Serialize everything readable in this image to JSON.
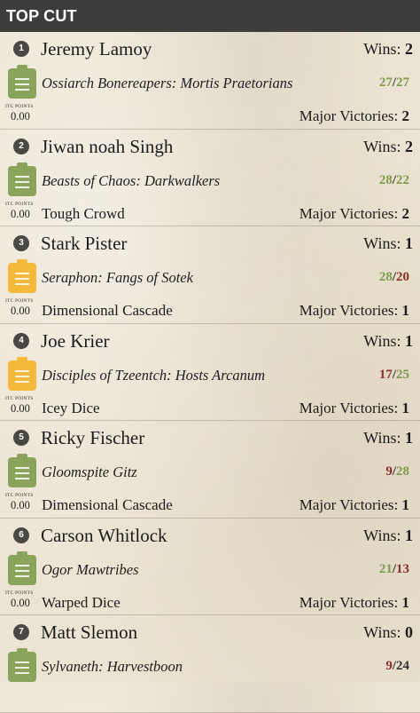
{
  "header": {
    "title": "TOP CUT"
  },
  "labels": {
    "wins": "Wins:",
    "major_victories": "Major Victories:",
    "itc_points": "ITC POINTS"
  },
  "players": [
    {
      "rank": "1",
      "name": "Jeremy Lamoy",
      "wins": "2",
      "faction": "Ossiarch Bonereapers: Mortis Praetorians",
      "record_a": "27",
      "record_b": "27",
      "color_a": "g",
      "color_b": "g",
      "itc": "0.00",
      "team": "",
      "major_victories": "2",
      "icon_color": "green"
    },
    {
      "rank": "2",
      "name": "Jiwan noah Singh",
      "wins": "2",
      "faction": "Beasts of Chaos: Darkwalkers",
      "record_a": "28",
      "record_b": "22",
      "color_a": "g",
      "color_b": "g",
      "itc": "0.00",
      "team": "Tough Crowd",
      "major_victories": "2",
      "icon_color": "green"
    },
    {
      "rank": "3",
      "name": "Stark Pister",
      "wins": "1",
      "faction": "Seraphon: Fangs of Sotek",
      "record_a": "28",
      "record_b": "20",
      "color_a": "g",
      "color_b": "r",
      "itc": "0.00",
      "team": "Dimensional Cascade",
      "major_victories": "1",
      "icon_color": "yellow"
    },
    {
      "rank": "4",
      "name": "Joe Krier",
      "wins": "1",
      "faction": "Disciples of Tzeentch: Hosts Arcanum",
      "record_a": "17",
      "record_b": "25",
      "color_a": "r",
      "color_b": "g",
      "itc": "0.00",
      "team": "Icey Dice",
      "major_victories": "1",
      "icon_color": "yellow"
    },
    {
      "rank": "5",
      "name": "Ricky Fischer",
      "wins": "1",
      "faction": "Gloomspite Gitz",
      "record_a": "9",
      "record_b": "28",
      "color_a": "r",
      "color_b": "g",
      "itc": "0.00",
      "team": "Dimensional Cascade",
      "major_victories": "1",
      "icon_color": "green"
    },
    {
      "rank": "6",
      "name": "Carson Whitlock",
      "wins": "1",
      "faction": "Ogor Mawtribes",
      "record_a": "21",
      "record_b": "13",
      "color_a": "g",
      "color_b": "r",
      "itc": "0.00",
      "team": "Warped Dice",
      "major_victories": "1",
      "icon_color": "green"
    },
    {
      "rank": "7",
      "name": "Matt Slemon",
      "wins": "0",
      "faction": "Sylvaneth: Harvestboon",
      "record_a": "9",
      "record_b": "24",
      "color_a": "r",
      "color_b": "k",
      "itc": "",
      "team": "",
      "major_victories": "",
      "icon_color": "green"
    }
  ]
}
